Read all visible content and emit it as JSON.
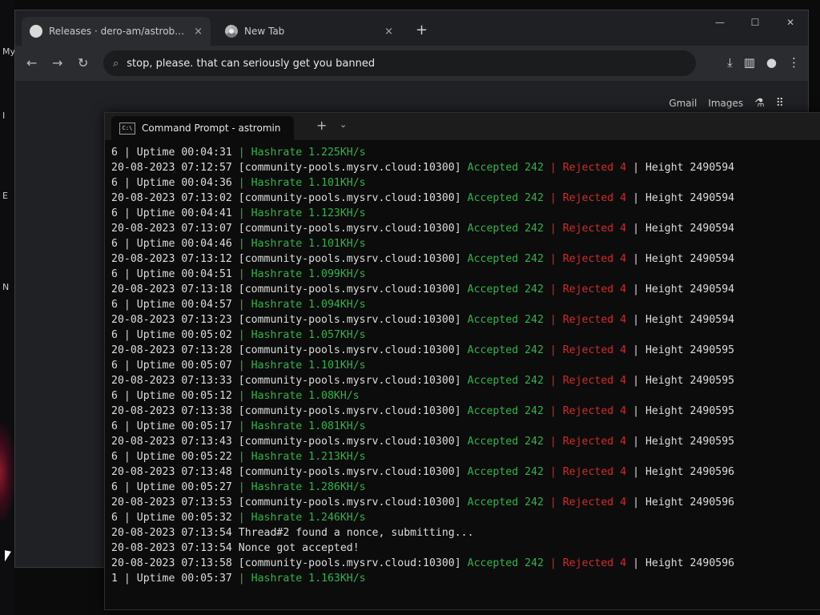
{
  "desktop": {
    "labels": [
      "My",
      "I",
      "E",
      "N"
    ]
  },
  "browser": {
    "tabs": [
      {
        "title": "Releases · dero-am/astrobwt-m",
        "close": "×",
        "icon": "github-icon",
        "active": true
      },
      {
        "title": "New Tab",
        "close": "×",
        "icon": "chrome-icon",
        "active": false
      }
    ],
    "new_tab": "+",
    "window_controls": [
      "—",
      "☐",
      "✕"
    ],
    "nav": {
      "back": "←",
      "forward": "→",
      "reload": "↻"
    },
    "address_text": "stop, please. that can seriously get you banned",
    "page_links": {
      "gmail": "Gmail",
      "images": "Images"
    }
  },
  "terminal": {
    "tab_title": "Command Prompt - astromin",
    "new_tab": "+",
    "dropdown": "⌄",
    "lines": [
      [
        {
          "t": "6 | Uptime 00:04:31 ",
          "c": "w"
        },
        {
          "t": "| Hashrate 1.225KH/s",
          "c": "g"
        }
      ],
      [
        {
          "t": "20-08-2023 07:12:57 [community-pools.mysrv.cloud:10300] ",
          "c": "w"
        },
        {
          "t": "Accepted 242 ",
          "c": "g"
        },
        {
          "t": "| Rejected 4 ",
          "c": "r"
        },
        {
          "t": "| Height 2490594",
          "c": "w"
        }
      ],
      [
        {
          "t": "6 | Uptime 00:04:36 ",
          "c": "w"
        },
        {
          "t": "| Hashrate 1.101KH/s",
          "c": "g"
        }
      ],
      [
        {
          "t": "20-08-2023 07:13:02 [community-pools.mysrv.cloud:10300] ",
          "c": "w"
        },
        {
          "t": "Accepted 242 ",
          "c": "g"
        },
        {
          "t": "| Rejected 4 ",
          "c": "r"
        },
        {
          "t": "| Height 2490594",
          "c": "w"
        }
      ],
      [
        {
          "t": "6 | Uptime 00:04:41 ",
          "c": "w"
        },
        {
          "t": "| Hashrate 1.123KH/s",
          "c": "g"
        }
      ],
      [
        {
          "t": "20-08-2023 07:13:07 [community-pools.mysrv.cloud:10300] ",
          "c": "w"
        },
        {
          "t": "Accepted 242 ",
          "c": "g"
        },
        {
          "t": "| Rejected 4 ",
          "c": "r"
        },
        {
          "t": "| Height 2490594",
          "c": "w"
        }
      ],
      [
        {
          "t": "6 | Uptime 00:04:46 ",
          "c": "w"
        },
        {
          "t": "| Hashrate 1.101KH/s",
          "c": "g"
        }
      ],
      [
        {
          "t": "20-08-2023 07:13:12 [community-pools.mysrv.cloud:10300] ",
          "c": "w"
        },
        {
          "t": "Accepted 242 ",
          "c": "g"
        },
        {
          "t": "| Rejected 4 ",
          "c": "r"
        },
        {
          "t": "| Height 2490594",
          "c": "w"
        }
      ],
      [
        {
          "t": "6 | Uptime 00:04:51 ",
          "c": "w"
        },
        {
          "t": "| Hashrate 1.099KH/s",
          "c": "g"
        }
      ],
      [
        {
          "t": "20-08-2023 07:13:18 [community-pools.mysrv.cloud:10300] ",
          "c": "w"
        },
        {
          "t": "Accepted 242 ",
          "c": "g"
        },
        {
          "t": "| Rejected 4 ",
          "c": "r"
        },
        {
          "t": "| Height 2490594",
          "c": "w"
        }
      ],
      [
        {
          "t": "6 | Uptime 00:04:57 ",
          "c": "w"
        },
        {
          "t": "| Hashrate 1.094KH/s",
          "c": "g"
        }
      ],
      [
        {
          "t": "20-08-2023 07:13:23 [community-pools.mysrv.cloud:10300] ",
          "c": "w"
        },
        {
          "t": "Accepted 242 ",
          "c": "g"
        },
        {
          "t": "| Rejected 4 ",
          "c": "r"
        },
        {
          "t": "| Height 2490594",
          "c": "w"
        }
      ],
      [
        {
          "t": "6 | Uptime 00:05:02 ",
          "c": "w"
        },
        {
          "t": "| Hashrate 1.057KH/s",
          "c": "g"
        }
      ],
      [
        {
          "t": "20-08-2023 07:13:28 [community-pools.mysrv.cloud:10300] ",
          "c": "w"
        },
        {
          "t": "Accepted 242 ",
          "c": "g"
        },
        {
          "t": "| Rejected 4 ",
          "c": "r"
        },
        {
          "t": "| Height 2490595",
          "c": "w"
        }
      ],
      [
        {
          "t": "6 | Uptime 00:05:07 ",
          "c": "w"
        },
        {
          "t": "| Hashrate 1.101KH/s",
          "c": "g"
        }
      ],
      [
        {
          "t": "20-08-2023 07:13:33 [community-pools.mysrv.cloud:10300] ",
          "c": "w"
        },
        {
          "t": "Accepted 242 ",
          "c": "g"
        },
        {
          "t": "| Rejected 4 ",
          "c": "r"
        },
        {
          "t": "| Height 2490595",
          "c": "w"
        }
      ],
      [
        {
          "t": "6 | Uptime 00:05:12 ",
          "c": "w"
        },
        {
          "t": "| Hashrate 1.08KH/s",
          "c": "g"
        }
      ],
      [
        {
          "t": "20-08-2023 07:13:38 [community-pools.mysrv.cloud:10300] ",
          "c": "w"
        },
        {
          "t": "Accepted 242 ",
          "c": "g"
        },
        {
          "t": "| Rejected 4 ",
          "c": "r"
        },
        {
          "t": "| Height 2490595",
          "c": "w"
        }
      ],
      [
        {
          "t": "6 | Uptime 00:05:17 ",
          "c": "w"
        },
        {
          "t": "| Hashrate 1.081KH/s",
          "c": "g"
        }
      ],
      [
        {
          "t": "20-08-2023 07:13:43 [community-pools.mysrv.cloud:10300] ",
          "c": "w"
        },
        {
          "t": "Accepted 242 ",
          "c": "g"
        },
        {
          "t": "| Rejected 4 ",
          "c": "r"
        },
        {
          "t": "| Height 2490595",
          "c": "w"
        }
      ],
      [
        {
          "t": "6 | Uptime 00:05:22 ",
          "c": "w"
        },
        {
          "t": "| Hashrate 1.213KH/s",
          "c": "g"
        }
      ],
      [
        {
          "t": "20-08-2023 07:13:48 [community-pools.mysrv.cloud:10300] ",
          "c": "w"
        },
        {
          "t": "Accepted 242 ",
          "c": "g"
        },
        {
          "t": "| Rejected 4 ",
          "c": "r"
        },
        {
          "t": "| Height 2490596",
          "c": "w"
        }
      ],
      [
        {
          "t": "6 | Uptime 00:05:27 ",
          "c": "w"
        },
        {
          "t": "| Hashrate 1.286KH/s",
          "c": "g"
        }
      ],
      [
        {
          "t": "20-08-2023 07:13:53 [community-pools.mysrv.cloud:10300] ",
          "c": "w"
        },
        {
          "t": "Accepted 242 ",
          "c": "g"
        },
        {
          "t": "| Rejected 4 ",
          "c": "r"
        },
        {
          "t": "| Height 2490596",
          "c": "w"
        }
      ],
      [
        {
          "t": "6 | Uptime 00:05:32 ",
          "c": "w"
        },
        {
          "t": "| Hashrate 1.246KH/s",
          "c": "g"
        }
      ],
      [
        {
          "t": "20-08-2023 07:13:54 Thread#2 found a nonce, submitting...",
          "c": "w"
        }
      ],
      [
        {
          "t": "20-08-2023 07:13:54 Nonce got accepted!",
          "c": "w"
        }
      ],
      [
        {
          "t": "20-08-2023 07:13:58 [community-pools.mysrv.cloud:10300] ",
          "c": "w"
        },
        {
          "t": "Accepted 242 ",
          "c": "g"
        },
        {
          "t": "| Rejected 4 ",
          "c": "r"
        },
        {
          "t": "| Height 2490596",
          "c": "w"
        }
      ],
      [
        {
          "t": "1 | Uptime 00:05:37 ",
          "c": "w"
        },
        {
          "t": "| Hashrate 1.163KH/s",
          "c": "g"
        }
      ]
    ]
  },
  "colors": {
    "accepted": "#2fb34a",
    "rejected": "#d02a2a",
    "text": "#dcdcdc",
    "terminal_bg": "#0c0c0c"
  }
}
